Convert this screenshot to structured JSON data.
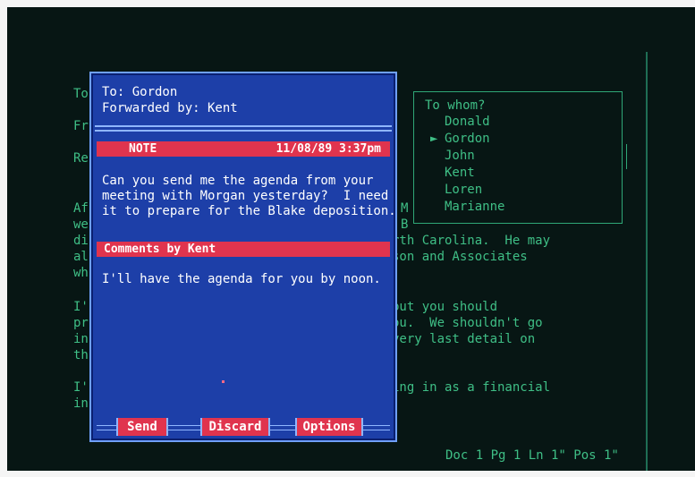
{
  "background_doc": {
    "left_fragments": [
      "To",
      "Fr",
      "Re",
      "Af",
      "we",
      "di",
      "al",
      "wh",
      "I'",
      "pr",
      "in",
      "th",
      "I'",
      "in"
    ],
    "right_fragments": [
      {
        "text": "M"
      },
      {
        "text": "B"
      },
      {
        "text": "rth Carolina.  He may"
      },
      {
        "text": "son and Associates"
      },
      {
        "text": "but you should"
      },
      {
        "text": "ou.  We shouldn't go"
      },
      {
        "text": "very last detail on"
      },
      {
        "text": "ing in as a financial"
      }
    ],
    "status_line": "Doc 1 Pg 1 Ln 1\" Pos 1\""
  },
  "whom_box": {
    "title": "To whom?",
    "items": [
      "Donald",
      "Gordon",
      "John",
      "Kent",
      "Loren",
      "Marianne"
    ],
    "selected_marker": "►"
  },
  "dialog": {
    "to_line": "To: Gordon",
    "forwarded_line": "Forwarded by: Kent",
    "note_label": "NOTE",
    "note_datetime": "11/08/89  3:37pm",
    "note_text": "Can you send me the agenda from your\nmeeting with Morgan yesterday?  I need\nit to prepare for the Blake deposition.",
    "comments_label": "Comments by Kent",
    "comment_text": "I'll have the agenda for you by noon.",
    "buttons": {
      "send": "Send",
      "discard": "Discard",
      "options": "Options"
    }
  },
  "colors": {
    "screen_bg": "#071614",
    "terminal_green": "#3fbf86",
    "dialog_blue": "#1d3fa8",
    "bar_red": "#e0344e"
  }
}
